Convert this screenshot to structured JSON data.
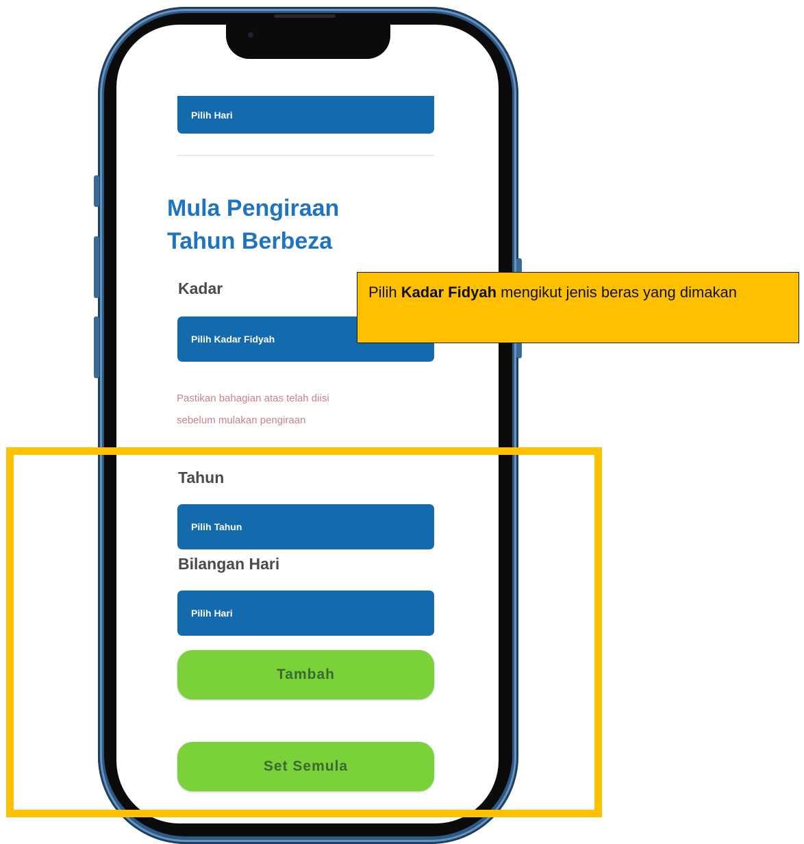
{
  "screen": {
    "top_select_label": "Pilih Hari",
    "section_title_line1": "Mula Pengiraan",
    "section_title_line2": "Tahun Berbeza",
    "kadar": {
      "label": "Kadar",
      "select_label": "Pilih Kadar Fidyah"
    },
    "warning_line1": "Pastikan bahagian atas telah diisi",
    "warning_line2": "sebelum mulakan pengiraan",
    "tahun": {
      "label": "Tahun",
      "select_label": "Pilih Tahun"
    },
    "bilangan_hari": {
      "label": "Bilangan Hari",
      "select_label": "Pilih Hari"
    },
    "add_button": "Tambah",
    "reset_button": "Set Semula"
  },
  "callout": {
    "text_before": "Pilih ",
    "text_bold": "Kadar Fidyah",
    "text_after": " mengikut jenis beras yang dimakan"
  },
  "colors": {
    "select_bg": "#136aad",
    "title_blue": "#1e73c2",
    "button_green": "#7ad13a",
    "highlight": "#ffc000",
    "warning_text": "#c9828b"
  }
}
